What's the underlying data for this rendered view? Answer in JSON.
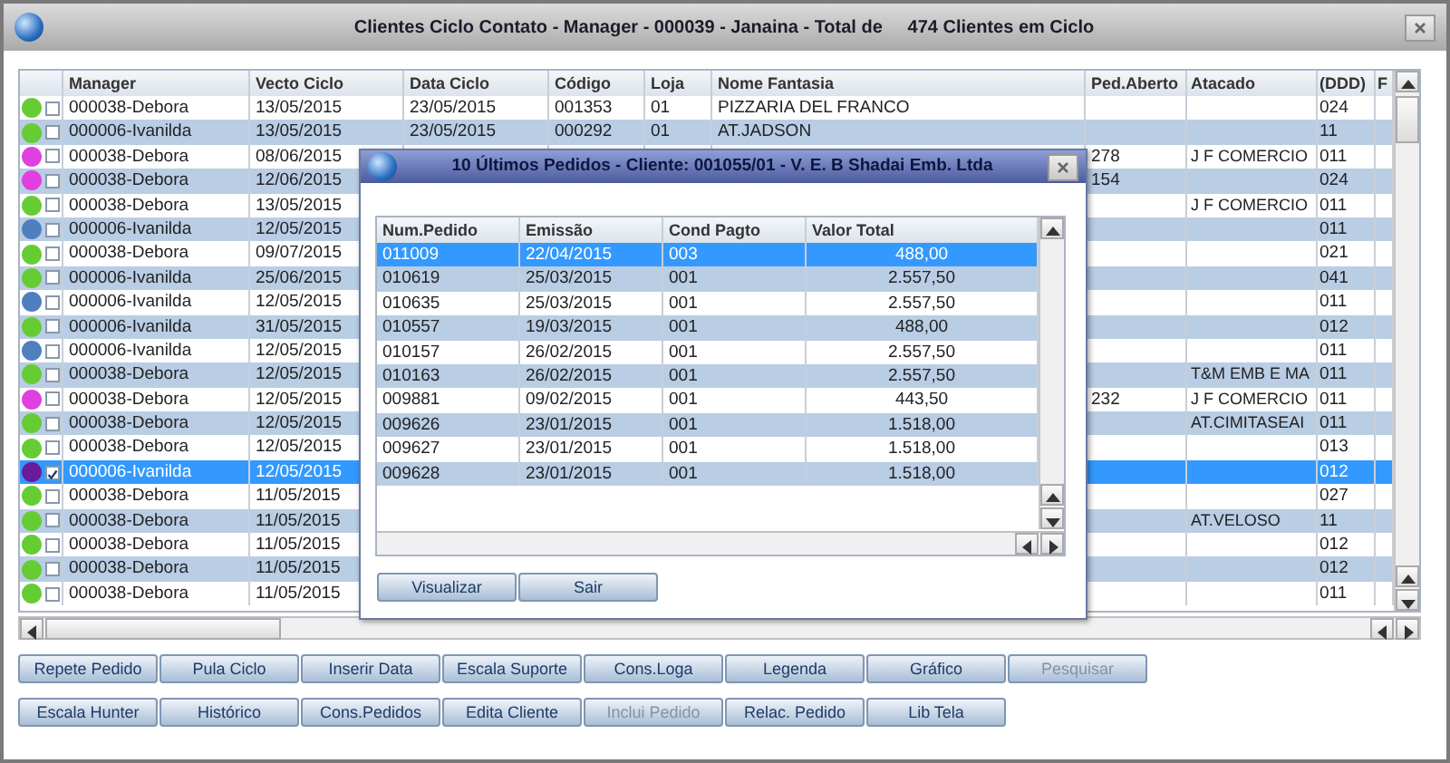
{
  "window": {
    "title": "Clientes Ciclo Contato - Manager - 000039 - Janaina - Total de     474 Clientes em Ciclo"
  },
  "table": {
    "columns": [
      "Manager",
      "Vecto Ciclo",
      "Data Ciclo",
      "Código",
      "Loja",
      "Nome Fantasia",
      "Ped.Aberto",
      "Atacado",
      "(DDD)",
      "F"
    ],
    "rows": [
      {
        "color": "#66cc33",
        "checked": false,
        "selected": false,
        "manager": "000038-Debora",
        "vecto_ciclo": "13/05/2015",
        "data_ciclo": "23/05/2015",
        "codigo": "001353",
        "loja": "01",
        "nome_fantasia": "PIZZARIA DEL FRANCO",
        "ddd": "024"
      },
      {
        "color": "#66cc33",
        "checked": false,
        "selected": false,
        "manager": "000006-Ivanilda",
        "vecto_ciclo": "13/05/2015",
        "data_ciclo": "23/05/2015",
        "codigo": "000292",
        "loja": "01",
        "nome_fantasia": "AT.JADSON",
        "ddd": "11"
      },
      {
        "color": "#e040e0",
        "checked": false,
        "selected": false,
        "manager": "000038-Debora",
        "vecto_ciclo": "08/06/2015",
        "ped_aberto": "278",
        "atacado": "J F COMERCIO",
        "ddd": "011"
      },
      {
        "color": "#e040e0",
        "checked": false,
        "selected": false,
        "manager": "000038-Debora",
        "vecto_ciclo": "12/06/2015",
        "ped_aberto": "154",
        "ddd": "024"
      },
      {
        "color": "#66cc33",
        "checked": false,
        "selected": false,
        "manager": "000038-Debora",
        "vecto_ciclo": "13/05/2015",
        "atacado": "J F COMERCIO",
        "ddd": "011"
      },
      {
        "color": "#4f7fbf",
        "checked": false,
        "selected": false,
        "manager": "000006-Ivanilda",
        "vecto_ciclo": "12/05/2015",
        "ddd": "011"
      },
      {
        "color": "#66cc33",
        "checked": false,
        "selected": false,
        "manager": "000038-Debora",
        "vecto_ciclo": "09/07/2015",
        "ddd": "021"
      },
      {
        "color": "#66cc33",
        "checked": false,
        "selected": false,
        "manager": "000006-Ivanilda",
        "vecto_ciclo": "25/06/2015",
        "ddd": "041"
      },
      {
        "color": "#4f7fbf",
        "checked": false,
        "selected": false,
        "manager": "000006-Ivanilda",
        "vecto_ciclo": "12/05/2015",
        "ddd": "011"
      },
      {
        "color": "#66cc33",
        "checked": false,
        "selected": false,
        "manager": "000006-Ivanilda",
        "vecto_ciclo": "31/05/2015",
        "ddd": "012"
      },
      {
        "color": "#4f7fbf",
        "checked": false,
        "selected": false,
        "manager": "000006-Ivanilda",
        "vecto_ciclo": "12/05/2015",
        "ddd": "011"
      },
      {
        "color": "#66cc33",
        "checked": false,
        "selected": false,
        "manager": "000038-Debora",
        "vecto_ciclo": "12/05/2015",
        "atacado": "T&M EMB E MA",
        "ddd": "011"
      },
      {
        "color": "#e040e0",
        "checked": false,
        "selected": false,
        "manager": "000038-Debora",
        "vecto_ciclo": "12/05/2015",
        "ped_aberto": "232",
        "atacado": "J F COMERCIO",
        "ddd": "011"
      },
      {
        "color": "#66cc33",
        "checked": false,
        "selected": false,
        "manager": "000038-Debora",
        "vecto_ciclo": "12/05/2015",
        "atacado": "AT.CIMITASEAI",
        "ddd": "011"
      },
      {
        "color": "#66cc33",
        "checked": false,
        "selected": false,
        "manager": "000038-Debora",
        "vecto_ciclo": "12/05/2015",
        "ddd": "013"
      },
      {
        "color": "#6a1b9a",
        "checked": true,
        "selected": true,
        "manager": "000006-Ivanilda",
        "vecto_ciclo": "12/05/2015",
        "ddd": "012"
      },
      {
        "color": "#66cc33",
        "checked": false,
        "selected": false,
        "manager": "000038-Debora",
        "vecto_ciclo": "11/05/2015",
        "ddd": "027"
      },
      {
        "color": "#66cc33",
        "checked": false,
        "selected": false,
        "manager": "000038-Debora",
        "vecto_ciclo": "11/05/2015",
        "atacado": "AT.VELOSO",
        "ddd": "11"
      },
      {
        "color": "#66cc33",
        "checked": false,
        "selected": false,
        "manager": "000038-Debora",
        "vecto_ciclo": "11/05/2015",
        "ddd": "012"
      },
      {
        "color": "#66cc33",
        "checked": false,
        "selected": false,
        "manager": "000038-Debora",
        "vecto_ciclo": "11/05/2015",
        "ddd": "012"
      },
      {
        "color": "#66cc33",
        "checked": false,
        "selected": false,
        "manager": "000038-Debora",
        "vecto_ciclo": "11/05/2015",
        "ddd": "011"
      }
    ]
  },
  "dialog": {
    "title": "10 Últimos Pedidos - Cliente: 001055/01 - V. E. B Shadai Emb. Ltda",
    "columns": [
      "Num.Pedido",
      "Emissão",
      "Cond Pagto",
      "Valor Total"
    ],
    "rows": [
      {
        "selected": true,
        "num_pedido": "011009",
        "emissao": "22/04/2015",
        "cond_pagto": "003",
        "valor_total": "488,00"
      },
      {
        "selected": false,
        "num_pedido": "010619",
        "emissao": "25/03/2015",
        "cond_pagto": "001",
        "valor_total": "2.557,50"
      },
      {
        "selected": false,
        "num_pedido": "010635",
        "emissao": "25/03/2015",
        "cond_pagto": "001",
        "valor_total": "2.557,50"
      },
      {
        "selected": false,
        "num_pedido": "010557",
        "emissao": "19/03/2015",
        "cond_pagto": "001",
        "valor_total": "488,00"
      },
      {
        "selected": false,
        "num_pedido": "010157",
        "emissao": "26/02/2015",
        "cond_pagto": "001",
        "valor_total": "2.557,50"
      },
      {
        "selected": false,
        "num_pedido": "010163",
        "emissao": "26/02/2015",
        "cond_pagto": "001",
        "valor_total": "2.557,50"
      },
      {
        "selected": false,
        "num_pedido": "009881",
        "emissao": "09/02/2015",
        "cond_pagto": "001",
        "valor_total": "443,50"
      },
      {
        "selected": false,
        "num_pedido": "009626",
        "emissao": "23/01/2015",
        "cond_pagto": "001",
        "valor_total": "1.518,00"
      },
      {
        "selected": false,
        "num_pedido": "009627",
        "emissao": "23/01/2015",
        "cond_pagto": "001",
        "valor_total": "1.518,00"
      },
      {
        "selected": false,
        "num_pedido": "009628",
        "emissao": "23/01/2015",
        "cond_pagto": "001",
        "valor_total": "1.518,00"
      }
    ],
    "buttons": [
      {
        "label": "Visualizar"
      },
      {
        "label": "Sair"
      }
    ]
  },
  "button_rows": [
    [
      {
        "label": "Repete Pedido",
        "disabled": false
      },
      {
        "label": "Pula Ciclo",
        "disabled": false
      },
      {
        "label": "Inserir Data",
        "disabled": false
      },
      {
        "label": "Escala Suporte",
        "disabled": false
      },
      {
        "label": "Cons.Loga",
        "disabled": false
      },
      {
        "label": "Legenda",
        "disabled": false
      },
      {
        "label": "Gráfico",
        "disabled": false
      },
      {
        "label": "Pesquisar",
        "disabled": true
      }
    ],
    [
      {
        "label": "Escala Hunter",
        "disabled": false
      },
      {
        "label": "Histórico",
        "disabled": false
      },
      {
        "label": "Cons.Pedidos",
        "disabled": false
      },
      {
        "label": "Edita Cliente",
        "disabled": false
      },
      {
        "label": "Inclui Pedido",
        "disabled": true
      },
      {
        "label": "Relac. Pedido",
        "disabled": false
      },
      {
        "label": "Lib Tela",
        "disabled": false
      }
    ]
  ]
}
